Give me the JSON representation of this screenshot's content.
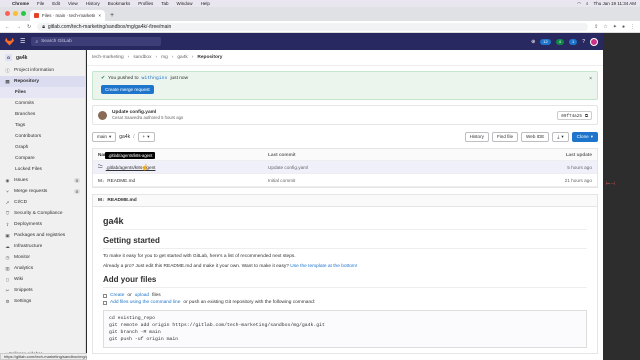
{
  "menubar": {
    "app": "Chrome",
    "items": [
      "File",
      "Edit",
      "View",
      "History",
      "Bookmarks",
      "Profiles",
      "Tab",
      "Window",
      "Help"
    ],
    "datetime": "Thu Jan 19 11:34 AM"
  },
  "browser": {
    "tab_title": "Files · main · tech-marketing / ...",
    "url": "gitlab.com/tech-marketing/sandbox/mg/ga4k/-/tree/main"
  },
  "gitlab_top": {
    "search_placeholder": "Search GitLab",
    "counts": {
      "issues": "12",
      "mrs": "4",
      "todos": "1"
    }
  },
  "sidebar": {
    "project_initial": "G",
    "project_name": "ga4k",
    "items": [
      {
        "label": "Project information",
        "icon": "info-icon"
      },
      {
        "label": "Repository",
        "icon": "doc-icon",
        "active": true
      },
      {
        "label": "Issues",
        "icon": "issues-icon",
        "count": "0"
      },
      {
        "label": "Merge requests",
        "icon": "merge-icon",
        "count": "0"
      },
      {
        "label": "CI/CD",
        "icon": "rocket-icon"
      },
      {
        "label": "Security & Compliance",
        "icon": "shield-icon"
      },
      {
        "label": "Deployments",
        "icon": "deploy-icon"
      },
      {
        "label": "Packages and registries",
        "icon": "package-icon"
      },
      {
        "label": "Infrastructure",
        "icon": "cloud-icon"
      },
      {
        "label": "Monitor",
        "icon": "monitor-icon"
      },
      {
        "label": "Analytics",
        "icon": "chart-icon"
      },
      {
        "label": "Wiki",
        "icon": "book-icon"
      },
      {
        "label": "Snippets",
        "icon": "snippet-icon"
      },
      {
        "label": "Settings",
        "icon": "gear-icon"
      }
    ],
    "repo_sub": [
      "Files",
      "Commits",
      "Branches",
      "Tags",
      "Contributors",
      "Graph",
      "Compare",
      "Locked Files"
    ],
    "collapse_label": "Collapse sidebar",
    "status_url": "https://gitlab.com/tech-marketing/sandbox/mg/ga4k/-/tree/main/.gitlab"
  },
  "breadcrumb": [
    "tech-marketing",
    "sandbox",
    "mg",
    "ga4k",
    "Repository"
  ],
  "alert": {
    "prefix": "You pushed to",
    "branch": "withngins",
    "suffix": "just now",
    "button": "Create merge request"
  },
  "commit": {
    "message": "Update config.yaml",
    "author": "Cesar Saavedra",
    "time": "authored 5 hours ago",
    "sha": "09f74a25"
  },
  "toolbar": {
    "branch": "main",
    "path": "ga4k",
    "history": "History",
    "find_file": "Find file",
    "web_ide": "Web IDE",
    "clone": "Clone"
  },
  "files": {
    "headers": {
      "name": "Name",
      "last_commit": "Last commit",
      "last_update": "Last update"
    },
    "tooltip": ".gitlab/agents/k8s-agent",
    "rows": [
      {
        "name": ".gitlab/agents/k8s-agent",
        "commit": "Update config.yaml",
        "updated": "5 hours ago",
        "icon": "folder-icon"
      },
      {
        "name": "README.md",
        "commit": "Initial commit",
        "updated": "21 hours ago",
        "icon": "markdown-icon"
      }
    ]
  },
  "readme": {
    "filename": "README.md",
    "title": "ga4k",
    "getting_started": "Getting started",
    "p1": "To make it easy for you to get started with GitLab, here's a list of recommended next steps.",
    "p2": "Already a pro? Just edit this README.md and make it your own. Want to make it easy?",
    "p2_link": "Use the template at the bottom!",
    "add_files": "Add your files",
    "check1_a": "Create",
    "check1_b": "or",
    "check1_c": "upload",
    "check1_d": "files",
    "check2_a": "Add files using the command line",
    "check2_b": "or push an existing Git repository with the following command:",
    "code": "cd existing_repo\ngit remote add origin https://gitlab.com/tech-marketing/sandbox/mg/ga4k.git\ngit branch -M main\ngit push -uf origin main"
  }
}
